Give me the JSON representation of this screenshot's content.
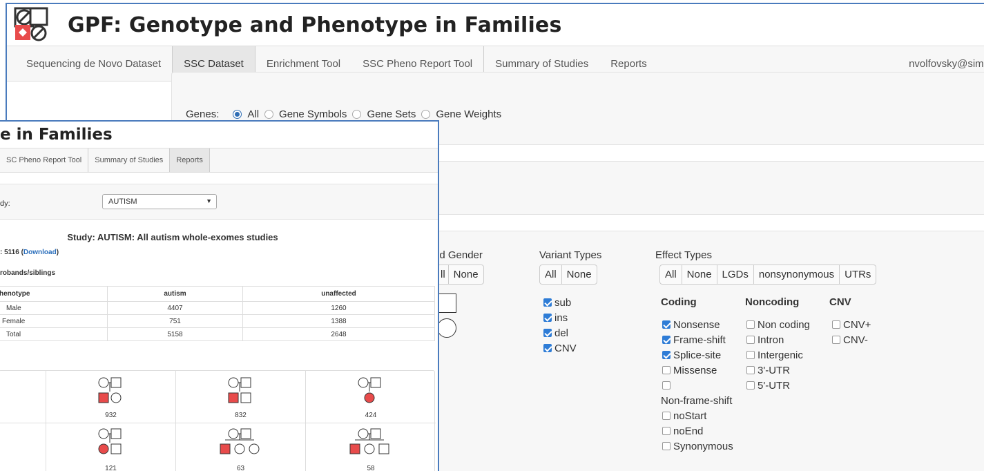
{
  "back": {
    "title": "GPF: Genotype and Phenotype in Families",
    "nav": [
      {
        "label": "Sequencing de Novo Dataset"
      },
      {
        "label": "SSC Dataset"
      },
      {
        "label": "Enrichment Tool"
      },
      {
        "label": "SSC Pheno Report Tool"
      },
      {
        "label": "Summary of Studies"
      },
      {
        "label": "Reports"
      }
    ],
    "user": "nvolfovsky@simo",
    "genes": {
      "label": "Genes:",
      "options": [
        "All",
        "Gene Symbols",
        "Gene Sets",
        "Gene Weights"
      ],
      "selected": "All"
    },
    "child_gender": {
      "label": "ld Gender",
      "buttons": [
        "ll",
        "None"
      ]
    },
    "variant_types": {
      "label": "Variant Types",
      "buttons": [
        "All",
        "None"
      ],
      "options": [
        {
          "label": "sub",
          "checked": true
        },
        {
          "label": "ins",
          "checked": true
        },
        {
          "label": "del",
          "checked": true
        },
        {
          "label": "CNV",
          "checked": true
        }
      ]
    },
    "effect_types": {
      "label": "Effect Types",
      "buttons": [
        "All",
        "None",
        "LGDs",
        "nonsynonymous",
        "UTRs"
      ],
      "coding_label": "Coding",
      "noncoding_label": "Noncoding",
      "cnv_label": "CNV",
      "coding": [
        {
          "label": "Nonsense",
          "checked": true
        },
        {
          "label": "Frame-shift",
          "checked": true
        },
        {
          "label": "Splice-site",
          "checked": true
        },
        {
          "label": "Missense",
          "checked": false
        },
        {
          "label": "",
          "checked": false
        },
        {
          "label": "Non-frame-shift",
          "checked": null
        },
        {
          "label": "noStart",
          "checked": false
        },
        {
          "label": "noEnd",
          "checked": false
        },
        {
          "label": "Synonymous",
          "checked": false
        }
      ],
      "noncoding": [
        {
          "label": "Non coding",
          "checked": false
        },
        {
          "label": "Intron",
          "checked": false
        },
        {
          "label": "Intergenic",
          "checked": false
        },
        {
          "label": "3'-UTR",
          "checked": false
        },
        {
          "label": "5'-UTR",
          "checked": false
        }
      ],
      "cnv": [
        {
          "label": "CNV+",
          "checked": false
        },
        {
          "label": "CNV-",
          "checked": false
        }
      ]
    }
  },
  "front": {
    "title": "e in Families",
    "nav": [
      {
        "label": "SC Pheno Report Tool"
      },
      {
        "label": "Summary of Studies"
      },
      {
        "label": "Reports"
      }
    ],
    "study_label": "dy:",
    "study_select": "AUTISM",
    "study_title": "Study: AUTISM: All autism whole-exomes studies",
    "count_prefix": ": 5116 (",
    "download": "Download",
    "count_suffix": ")",
    "probands_label": "robands/siblings",
    "table": {
      "headers": [
        "henotype",
        "autism",
        "unaffected"
      ],
      "rows": [
        {
          "label": "Male",
          "autism": "4407",
          "unaffected": "1260"
        },
        {
          "label": "Female",
          "autism": "751",
          "unaffected": "1388"
        },
        {
          "label": "Total",
          "autism": "5158",
          "unaffected": "2648"
        }
      ]
    },
    "family_counts": [
      "932",
      "832",
      "424",
      "121",
      "63",
      "58"
    ]
  }
}
